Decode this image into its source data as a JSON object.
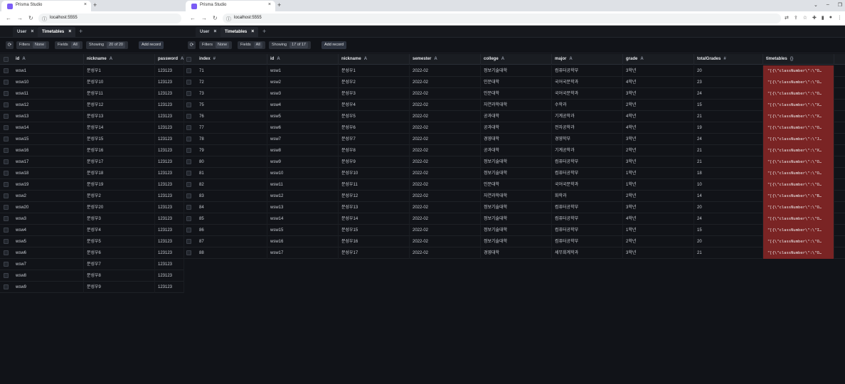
{
  "browser": {
    "tab_title": "Prisma Studio",
    "url": "localhost:5555",
    "new_tab_symbol": "+",
    "close_symbol": "×"
  },
  "window1": {
    "tabs": [
      {
        "label": "User",
        "active": false
      },
      {
        "label": "Timetables",
        "active": true
      }
    ],
    "toolbar": {
      "filters_label": "Filters",
      "filters_value": "None",
      "fields_label": "Fields",
      "fields_value": "All",
      "showing_label": "Showing",
      "showing_value": "20 of 20",
      "add_record": "Add record"
    },
    "columns": [
      {
        "label": "id",
        "type": "A"
      },
      {
        "label": "nickname",
        "type": "A"
      },
      {
        "label": "password",
        "type": "A"
      }
    ],
    "rows": [
      [
        "wsw1",
        "문성우1",
        "123123"
      ],
      [
        "wsw10",
        "문성우10",
        "123123"
      ],
      [
        "wsw11",
        "문성우11",
        "123123"
      ],
      [
        "wsw12",
        "문성우12",
        "123123"
      ],
      [
        "wsw13",
        "문성우13",
        "123123"
      ],
      [
        "wsw14",
        "문성우14",
        "123123"
      ],
      [
        "wsw15",
        "문성우15",
        "123123"
      ],
      [
        "wsw16",
        "문성우16",
        "123123"
      ],
      [
        "wsw17",
        "문성우17",
        "123123"
      ],
      [
        "wsw18",
        "문성우18",
        "123123"
      ],
      [
        "wsw19",
        "문성우19",
        "123123"
      ],
      [
        "wsw2",
        "문성우2",
        "123123"
      ],
      [
        "wsw20",
        "문성우20",
        "123123"
      ],
      [
        "wsw3",
        "문성우3",
        "123123"
      ],
      [
        "wsw4",
        "문성우4",
        "123123"
      ],
      [
        "wsw5",
        "문성우5",
        "123123"
      ],
      [
        "wsw6",
        "문성우6",
        "123123"
      ],
      [
        "wsw7",
        "문성우7",
        "123123"
      ],
      [
        "wsw8",
        "문성우8",
        "123123"
      ],
      [
        "wsw9",
        "문성우9",
        "123123"
      ]
    ]
  },
  "window2": {
    "tabs": [
      {
        "label": "User",
        "active": false
      },
      {
        "label": "Timetables",
        "active": true
      }
    ],
    "toolbar": {
      "filters_label": "Filters",
      "filters_value": "None",
      "fields_label": "Fields",
      "fields_value": "All",
      "showing_label": "Showing",
      "showing_value": "17 of 17",
      "add_record": "Add record"
    },
    "columns": [
      {
        "label": "index",
        "type": "#"
      },
      {
        "label": "id",
        "type": "A"
      },
      {
        "label": "nickname",
        "type": "A"
      },
      {
        "label": "semester",
        "type": "A"
      },
      {
        "label": "college",
        "type": "A"
      },
      {
        "label": "major",
        "type": "A"
      },
      {
        "label": "grade",
        "type": "A"
      },
      {
        "label": "totalGrades",
        "type": "#"
      },
      {
        "label": "timetables",
        "type": "{}"
      }
    ],
    "rows": [
      [
        "71",
        "wsw1",
        "문성우1",
        "2022-02",
        "정보기술대학",
        "컴퓨터공학부",
        "3학년",
        "20",
        "\"[{\\\"classNumber\\\":\\\"O…"
      ],
      [
        "72",
        "wsw2",
        "문성우2",
        "2022-02",
        "인문대학",
        "국어국문학과",
        "4학년",
        "23",
        "\"[{\\\"classNumber\\\":\\\"O…"
      ],
      [
        "73",
        "wsw3",
        "문성우3",
        "2022-02",
        "인문대학",
        "국어국문학과",
        "3학년",
        "24",
        "\"[{\\\"classNumber\\\":\\\"O…"
      ],
      [
        "75",
        "wsw4",
        "문성우4",
        "2022-02",
        "자연과학대학",
        "수학과",
        "2학년",
        "15",
        "\"[{\\\"classNumber\\\":\\\"X…"
      ],
      [
        "76",
        "wsw5",
        "문성우5",
        "2022-02",
        "공과대학",
        "기계공학과",
        "4학년",
        "21",
        "\"[{\\\"classNumber\\\":\\\"X…"
      ],
      [
        "77",
        "wsw6",
        "문성우6",
        "2022-02",
        "공과대학",
        "전자공학과",
        "4학년",
        "19",
        "\"[{\\\"classNumber\\\":\\\"O…"
      ],
      [
        "78",
        "wsw7",
        "문성우7",
        "2022-02",
        "경영대학",
        "경영학부",
        "3학년",
        "24",
        "\"[{\\\"classNumber\\\":\\\"J…"
      ],
      [
        "79",
        "wsw8",
        "문성우8",
        "2022-02",
        "공과대학",
        "기계공학과",
        "2학년",
        "21",
        "\"[{\\\"classNumber\\\":\\\"X…"
      ],
      [
        "80",
        "wsw9",
        "문성우9",
        "2022-02",
        "정보기술대학",
        "컴퓨터공학부",
        "3학년",
        "21",
        "\"[{\\\"classNumber\\\":\\\"O…"
      ],
      [
        "81",
        "wsw10",
        "문성우10",
        "2022-02",
        "정보기술대학",
        "컴퓨터공학부",
        "1학년",
        "18",
        "\"[{\\\"classNumber\\\":\\\"O…"
      ],
      [
        "82",
        "wsw11",
        "문성우11",
        "2022-02",
        "인문대학",
        "국어국문학과",
        "1학년",
        "10",
        "\"[{\\\"classNumber\\\":\\\"O…"
      ],
      [
        "83",
        "wsw12",
        "문성우12",
        "2022-02",
        "자연과학대학",
        "화학과",
        "2학년",
        "14",
        "\"[{\\\"classNumber\\\":\\\"B…"
      ],
      [
        "84",
        "wsw13",
        "문성우13",
        "2022-02",
        "정보기술대학",
        "컴퓨터공학부",
        "3학년",
        "20",
        "\"[{\\\"classNumber\\\":\\\"O…"
      ],
      [
        "85",
        "wsw14",
        "문성우14",
        "2022-02",
        "정보기술대학",
        "컴퓨터공학부",
        "4학년",
        "24",
        "\"[{\\\"classNumber\\\":\\\"O…"
      ],
      [
        "86",
        "wsw15",
        "문성우15",
        "2022-02",
        "정보기술대학",
        "컴퓨터공학부",
        "1학년",
        "15",
        "\"[{\\\"classNumber\\\":\\\"I…"
      ],
      [
        "87",
        "wsw16",
        "문성우16",
        "2022-02",
        "정보기술대학",
        "컴퓨터공학부",
        "2학년",
        "20",
        "\"[{\\\"classNumber\\\":\\\"O…"
      ],
      [
        "88",
        "wsw17",
        "문성우17",
        "2022-02",
        "경영대학",
        "세무회계학과",
        "3학년",
        "21",
        "\"[{\\\"classNumber\\\":\\\"O…"
      ]
    ]
  }
}
